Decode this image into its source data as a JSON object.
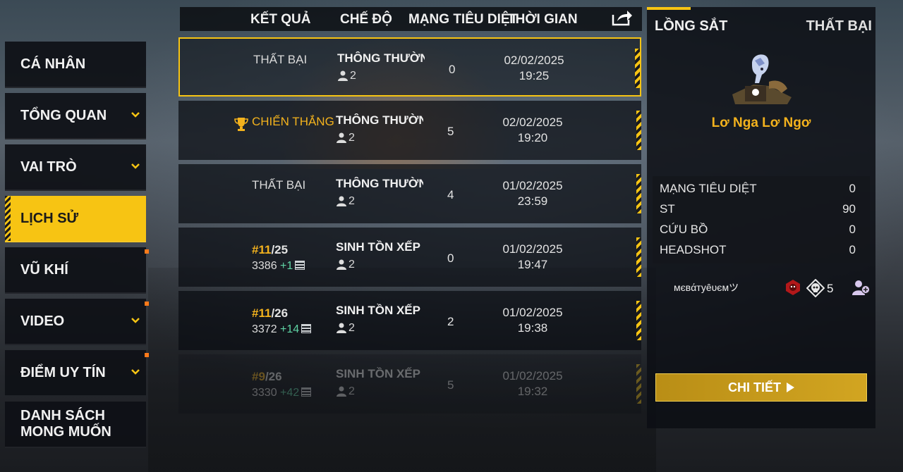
{
  "sidebar": {
    "items": [
      {
        "label": "CÁ NHÂN"
      },
      {
        "label": "TỔNG QUAN"
      },
      {
        "label": "VAI TRÒ"
      },
      {
        "label": "LỊCH SỬ"
      },
      {
        "label": "VŨ KHÍ"
      },
      {
        "label": "VIDEO"
      },
      {
        "label": "ĐIỂM UY TÍN"
      },
      {
        "label_line1": "DANH SÁCH",
        "label_line2": "MONG MUỐN"
      }
    ],
    "active_index": 3
  },
  "header": {
    "result": "KẾT QUẢ",
    "mode": "CHẾ ĐỘ",
    "kills": "MẠNG TIÊU DIỆT",
    "time": "THỜI GIAN",
    "share_icon": "share-icon"
  },
  "matches": [
    {
      "result": "THẤT BẠI",
      "mode": "THÔNG THƯỜNG-KHU",
      "team": "2",
      "kills": "0",
      "date": "02/02/2025",
      "time": "19:25"
    },
    {
      "result": "CHIẾN THẮNG",
      "mode": "THÔNG THƯỜNG-KHU",
      "team": "2",
      "kills": "5",
      "date": "02/02/2025",
      "time": "19:20"
    },
    {
      "result": "THẤT BẠI",
      "mode": "THÔNG THƯỜNG-KHU",
      "team": "2",
      "kills": "4",
      "date": "01/02/2025",
      "time": "23:59"
    },
    {
      "rank": "11",
      "total": "/25",
      "points": "3386",
      "delta": "+1",
      "mode": "SINH TỒN XẾP HẠNG",
      "team": "2",
      "kills": "0",
      "date": "01/02/2025",
      "time": "19:47"
    },
    {
      "rank": "11",
      "total": "/26",
      "points": "3372",
      "delta": "+14",
      "mode": "SINH TỒN XẾP HẠNG",
      "team": "2",
      "kills": "2",
      "date": "01/02/2025",
      "time": "19:38"
    },
    {
      "rank": "9",
      "total": "/26",
      "points": "3330",
      "delta": "+42",
      "mode": "SINH TỒN XẾP HẠNG",
      "team": "2",
      "kills": "5",
      "date": "01/02/2025",
      "time": "19:32"
    }
  ],
  "detail": {
    "map": "LỒNG SẮT",
    "result": "THẤT BẠI",
    "player_name": "Lơ Nga Lơ Ngơ",
    "stats": [
      {
        "label": "MẠNG TIÊU DIỆT",
        "value": "0"
      },
      {
        "label": "ST",
        "value": "90"
      },
      {
        "label": "CỨU BỒ",
        "value": "0"
      },
      {
        "label": "HEADSHOT",
        "value": "0"
      }
    ],
    "teammate": {
      "name": "мєвάтуêυємツ",
      "kills": "5"
    },
    "detail_button": "CHI TIẾT"
  },
  "colors": {
    "accent": "#f7c413",
    "win": "#f3b21d",
    "gain": "#5fd4a4"
  }
}
